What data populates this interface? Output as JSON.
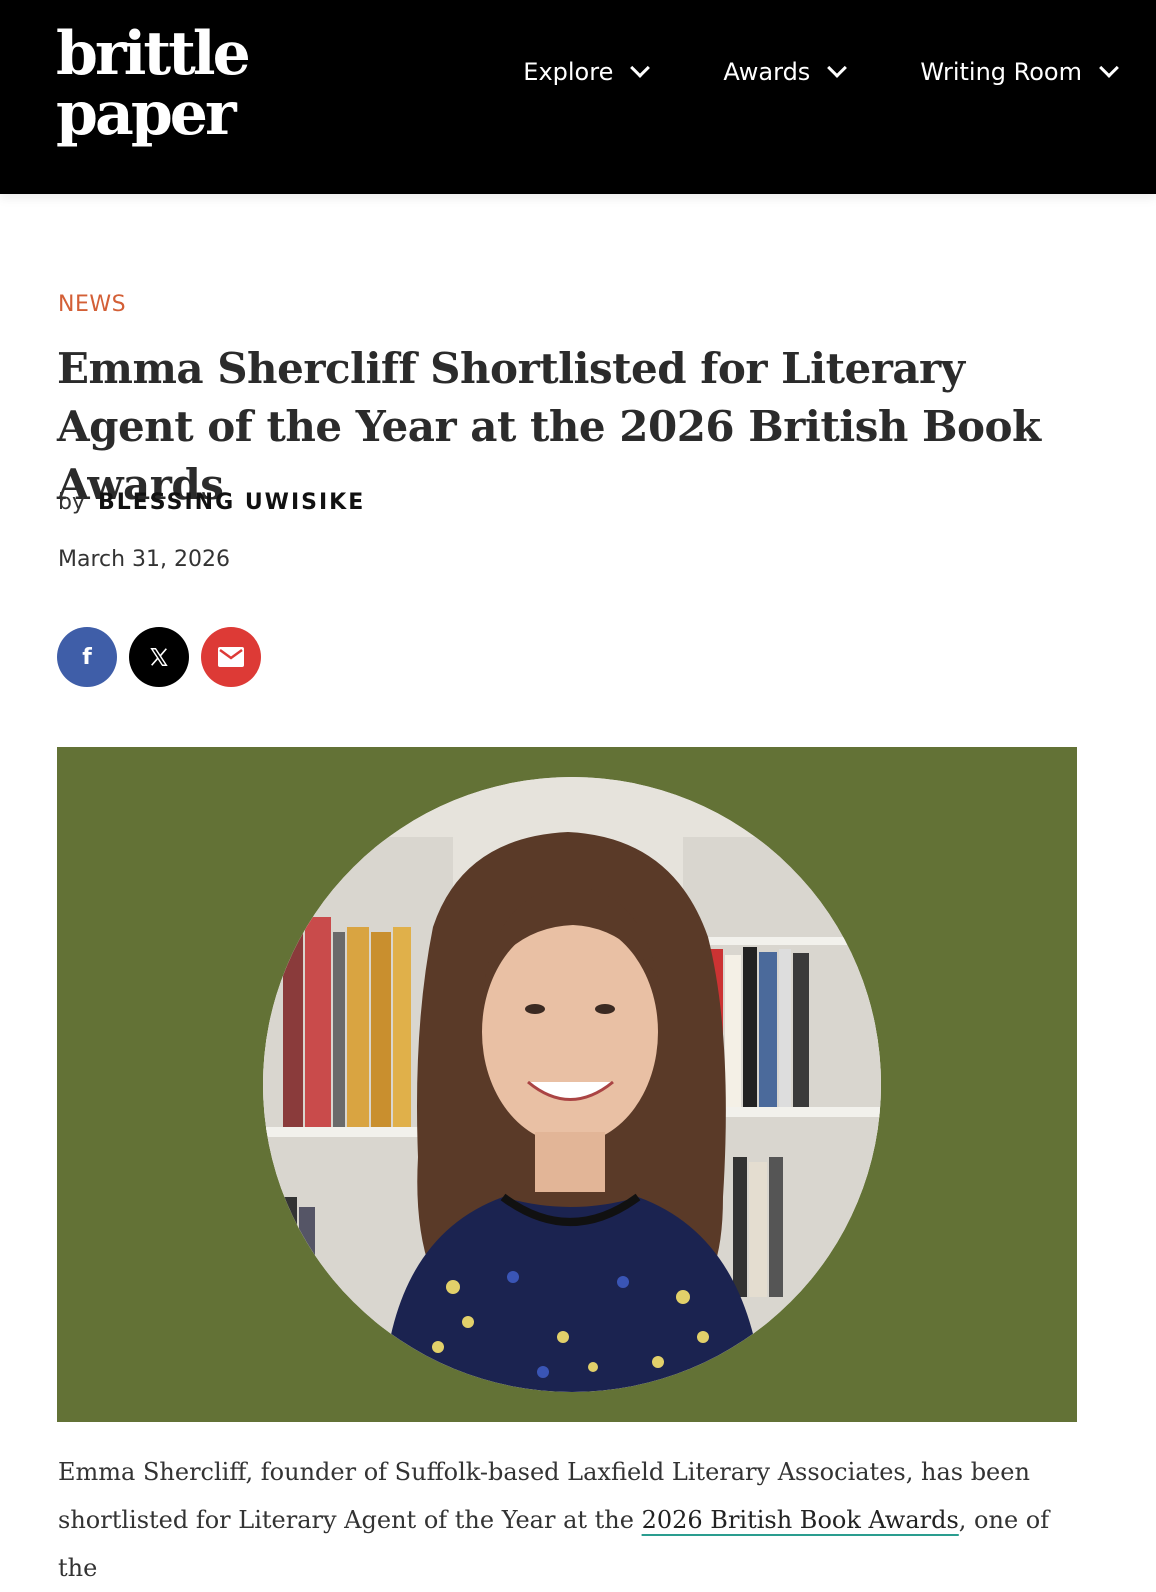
{
  "header": {
    "logo_line1": "brittle",
    "logo_line2": "paper",
    "nav": [
      {
        "label": "Explore"
      },
      {
        "label": "Awards"
      },
      {
        "label": "Writing Room"
      }
    ]
  },
  "article": {
    "category": "NEWS",
    "title": "Emma Shercliff Shortlisted for Literary Agent of the Year at the 2026 British Book Awards",
    "byline_prefix": "by",
    "author": "BLESSING UWISIKE",
    "date": "March 31, 2026",
    "share": {
      "facebook_icon": "facebook-icon",
      "x_icon": "x-twitter-icon",
      "email_icon": "email-icon",
      "facebook_glyph": "f"
    },
    "feature_image": {
      "background_color": "#637236",
      "subject": "portrait-photo"
    },
    "body_part1": "Emma Shercliff, founder of Suffolk-based Laxfield Literary Associates, has been shortlisted for Literary Agent of the Year at the ",
    "body_link": "2026 British Book Awards",
    "body_part2": ", one of the"
  },
  "colors": {
    "header_bg": "#000000",
    "category": "#d35f36",
    "facebook": "#3f5ea8",
    "x": "#000000",
    "email": "#dd3a36",
    "link_underline": "#2a9d8f"
  }
}
